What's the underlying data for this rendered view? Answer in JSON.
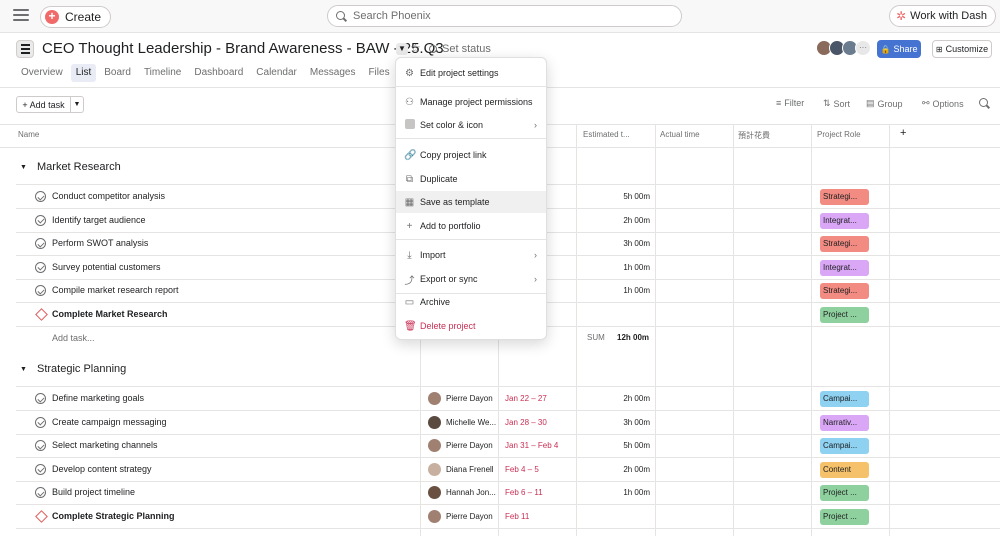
{
  "topbar": {
    "create_label": "Create",
    "search_placeholder": "Search Phoenix",
    "dash_label": "Work with Dash"
  },
  "project": {
    "title": "CEO Thought Leadership - Brand Awareness - BAW - 25.Q3",
    "set_status": "Set status",
    "share": "Share",
    "customize": "Customize",
    "avatar_more": "···"
  },
  "tabs": [
    "Overview",
    "List",
    "Board",
    "Timeline",
    "Dashboard",
    "Calendar",
    "Messages",
    "Files"
  ],
  "toolbar": {
    "add_task": "Add task",
    "filter": "Filter",
    "sort": "Sort",
    "group": "Group",
    "options": "Options"
  },
  "columns": {
    "name": "Name",
    "estimated": "Estimated t...",
    "actual": "Actual time",
    "cost": "預計花費",
    "role": "Project Role",
    "add": "+"
  },
  "sections": [
    {
      "title": "Market Research",
      "add_task": "Add task...",
      "sum_label": "SUM",
      "sum_value": "12h 00m",
      "rows": [
        {
          "name": "Conduct competitor analysis",
          "est": "5h 00m",
          "tag": "Strategi...",
          "tag_color": "#f28b82",
          "milestone": false
        },
        {
          "name": "Identify target audience",
          "est": "2h 00m",
          "tag": "Integrat...",
          "tag_color": "#d9a7f5",
          "milestone": false
        },
        {
          "name": "Perform SWOT analysis",
          "est": "3h 00m",
          "tag": "Strategi...",
          "tag_color": "#f28b82",
          "milestone": false
        },
        {
          "name": "Survey potential customers",
          "est": "1h 00m",
          "tag": "Integrat...",
          "tag_color": "#d9a7f5",
          "milestone": false
        },
        {
          "name": "Compile market research report",
          "est": "1h 00m",
          "tag": "Strategi...",
          "tag_color": "#f28b82",
          "milestone": false
        },
        {
          "name": "Complete Market Research",
          "est": "",
          "tag": "Project ...",
          "tag_color": "#8fd19e",
          "milestone": true
        }
      ]
    },
    {
      "title": "Strategic Planning",
      "rows": [
        {
          "name": "Define marketing goals",
          "assignee": "Pierre Dayon",
          "due": "Jan 22 – 27",
          "est": "2h 00m",
          "tag": "Campai...",
          "tag_color": "#8ed1f0",
          "milestone": false
        },
        {
          "name": "Create campaign messaging",
          "assignee": "Michelle We...",
          "due": "Jan 28 – 30",
          "est": "3h 00m",
          "tag": "Narrativ...",
          "tag_color": "#d9a7f5",
          "milestone": false
        },
        {
          "name": "Select marketing channels",
          "assignee": "Pierre Dayon",
          "due": "Jan 31 – Feb 4",
          "est": "5h 00m",
          "tag": "Campai...",
          "tag_color": "#8ed1f0",
          "milestone": false
        },
        {
          "name": "Develop content strategy",
          "assignee": "Diana Frenell",
          "due": "Feb 4 – 5",
          "est": "2h 00m",
          "tag": "Content",
          "tag_color": "#f5c26b",
          "milestone": false
        },
        {
          "name": "Build project timeline",
          "assignee": "Hannah Jon...",
          "due": "Feb 6 – 11",
          "est": "1h 00m",
          "tag": "Project ...",
          "tag_color": "#8fd19e",
          "milestone": false
        },
        {
          "name": "Complete Strategic Planning",
          "assignee": "Pierre Dayon",
          "due": "Feb 11",
          "est": "",
          "tag": "Project ...",
          "tag_color": "#8fd19e",
          "milestone": true
        }
      ]
    }
  ],
  "menu": {
    "items": [
      {
        "label": "Edit project settings",
        "icon": "gear-icon",
        "glyph": "⚙"
      },
      {
        "label": "Manage project permissions",
        "icon": "permissions-icon",
        "glyph": "⚇"
      },
      {
        "label": "Set color & icon",
        "icon": "color-swatch-icon",
        "glyph": ""
      },
      {
        "label": "Copy project link",
        "icon": "link-icon",
        "glyph": "🔗"
      },
      {
        "label": "Duplicate",
        "icon": "duplicate-icon",
        "glyph": "⧉"
      },
      {
        "label": "Save as template",
        "icon": "template-icon",
        "glyph": "▦"
      },
      {
        "label": "Add to portfolio",
        "icon": "plus-icon",
        "glyph": "+"
      },
      {
        "label": "Import",
        "icon": "import-icon",
        "glyph": "⤓"
      },
      {
        "label": "Export or sync",
        "icon": "export-icon",
        "glyph": "⤴"
      },
      {
        "label": "Archive",
        "icon": "archive-icon",
        "glyph": "▭"
      },
      {
        "label": "Delete project",
        "icon": "trash-icon",
        "glyph": "🗑"
      }
    ],
    "hovered": "Save as template"
  },
  "colors": {
    "accent": "#4573d2",
    "create": "#f06a6a",
    "due_text": "#c92f54"
  }
}
